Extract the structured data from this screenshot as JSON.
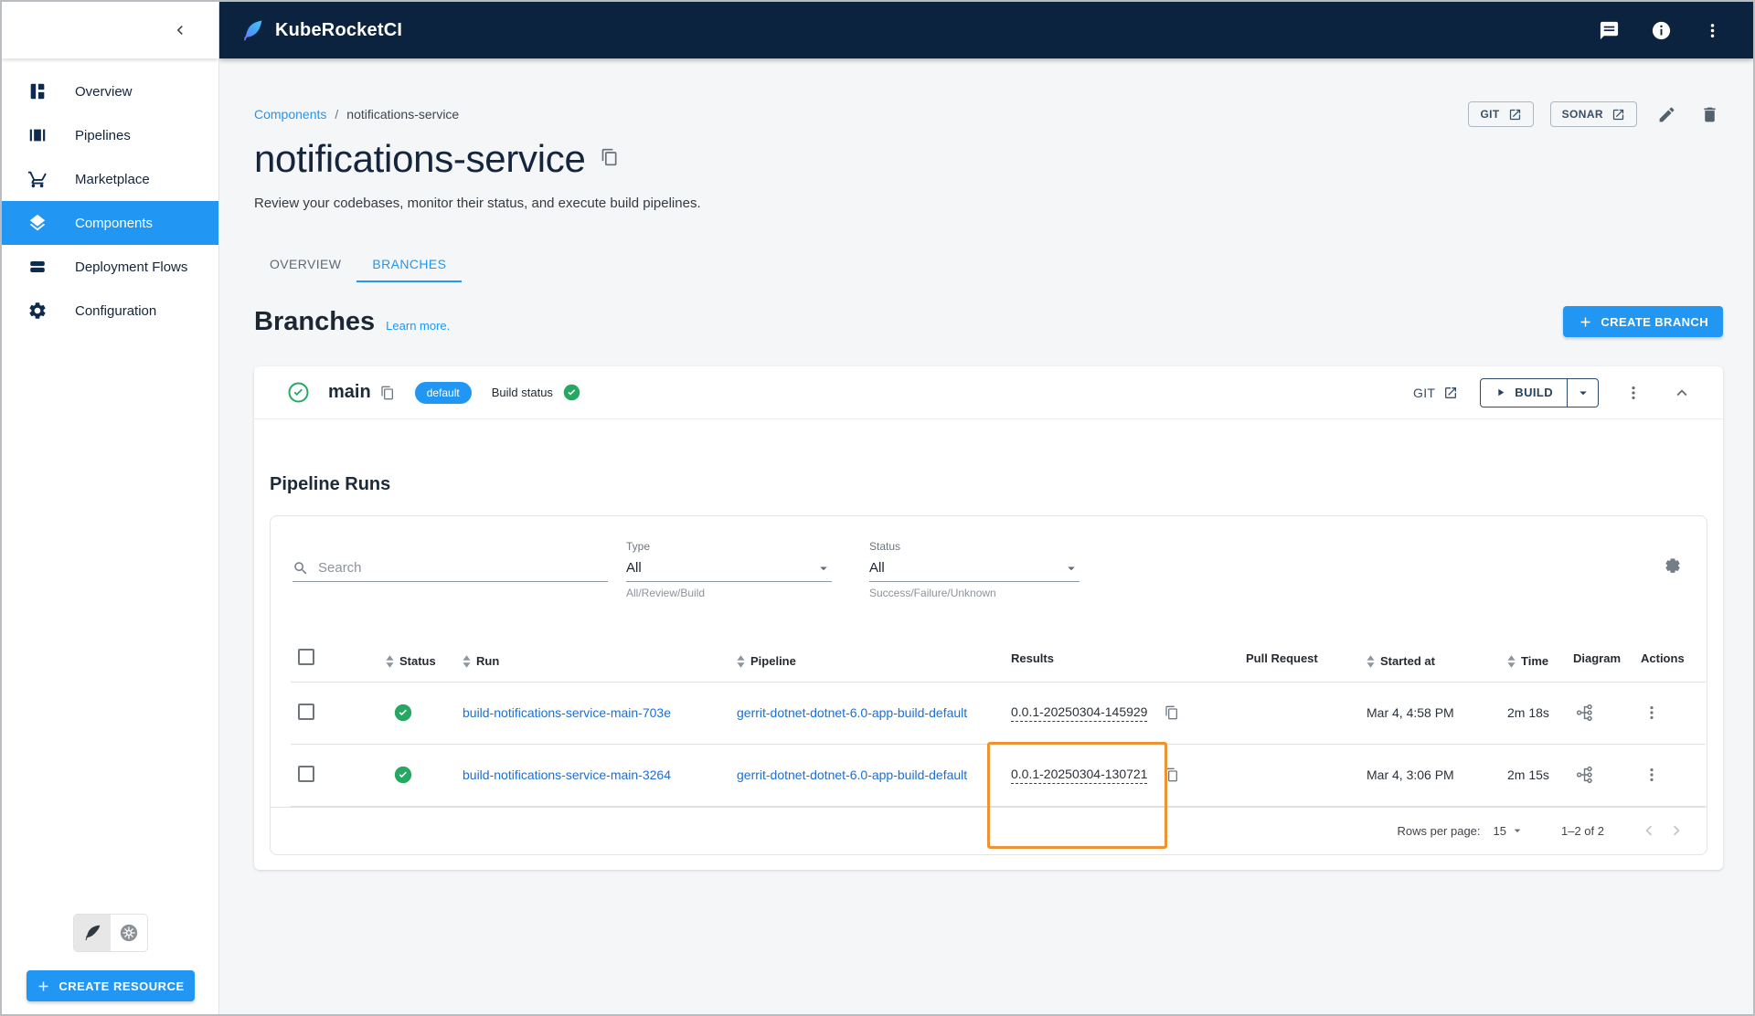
{
  "app": {
    "name": "KubeRocketCI"
  },
  "topbar": {
    "icons": [
      "chat-icon",
      "info-icon",
      "kebab-menu-icon"
    ]
  },
  "sidebar": {
    "collapse_icon": "chevron-left-icon",
    "items": [
      {
        "label": "Overview",
        "icon": "dashboard-icon",
        "active": false
      },
      {
        "label": "Pipelines",
        "icon": "pipelines-icon",
        "active": false
      },
      {
        "label": "Marketplace",
        "icon": "cart-icon",
        "active": false
      },
      {
        "label": "Components",
        "icon": "layers-icon",
        "active": true
      },
      {
        "label": "Deployment Flows",
        "icon": "stacks-icon",
        "active": false
      },
      {
        "label": "Configuration",
        "icon": "gear-icon",
        "active": false
      }
    ],
    "footer": {
      "toggle_icons": [
        "feather-icon",
        "kubernetes-icon"
      ],
      "create_resource_label": "CREATE RESOURCE"
    }
  },
  "breadcrumb": {
    "root": "Components",
    "separator": "/",
    "current": "notifications-service"
  },
  "page": {
    "title": "notifications-service",
    "subtitle": "Review your codebases, monitor their status, and execute build pipelines.",
    "actions": {
      "git": "GIT",
      "sonar": "SONAR"
    }
  },
  "tabs": {
    "overview": "OVERVIEW",
    "branches": "BRANCHES",
    "active_tab": "BRANCHES"
  },
  "branches_section": {
    "heading": "Branches",
    "learn_more": "Learn more.",
    "create_branch": "CREATE BRANCH"
  },
  "branch": {
    "name": "main",
    "default_chip": "default",
    "build_status_label": "Build status",
    "build_status": "success",
    "git_link": "GIT",
    "build_button": "BUILD"
  },
  "pipeline_runs": {
    "heading": "Pipeline Runs",
    "search_placeholder": "Search",
    "type_filter": {
      "label": "Type",
      "value": "All",
      "helper": "All/Review/Build"
    },
    "status_filter": {
      "label": "Status",
      "value": "All",
      "helper": "Success/Failure/Unknown"
    },
    "columns": {
      "status": "Status",
      "run": "Run",
      "pipeline": "Pipeline",
      "results": "Results",
      "pull_request": "Pull Request",
      "started_at": "Started at",
      "time": "Time",
      "diagram": "Diagram",
      "actions": "Actions"
    },
    "rows": [
      {
        "status": "success",
        "run": "build-notifications-service-main-703e",
        "pipeline": "gerrit-dotnet-dotnet-6.0-app-build-default",
        "result": "0.0.1-20250304-145929",
        "pull_request": "",
        "started_at": "Mar 4, 4:58 PM",
        "time": "2m 18s"
      },
      {
        "status": "success",
        "run": "build-notifications-service-main-3264",
        "pipeline": "gerrit-dotnet-dotnet-6.0-app-build-default",
        "result": "0.0.1-20250304-130721",
        "pull_request": "",
        "started_at": "Mar 4, 3:06 PM",
        "time": "2m 15s"
      }
    ],
    "pagination": {
      "rows_per_page_label": "Rows per page:",
      "rows_per_page_value": "15",
      "range": "1–2 of 2"
    }
  },
  "annotation": {
    "highlighted_column": "Results",
    "highlight_color": "#EF9234"
  },
  "colors": {
    "header_bg": "#0C2340",
    "accent_blue": "#2196F3",
    "success_green": "#26A862",
    "link_blue": "#1D6FD2",
    "page_bg": "#F5F6F8",
    "highlight_orange": "#EF9234"
  }
}
